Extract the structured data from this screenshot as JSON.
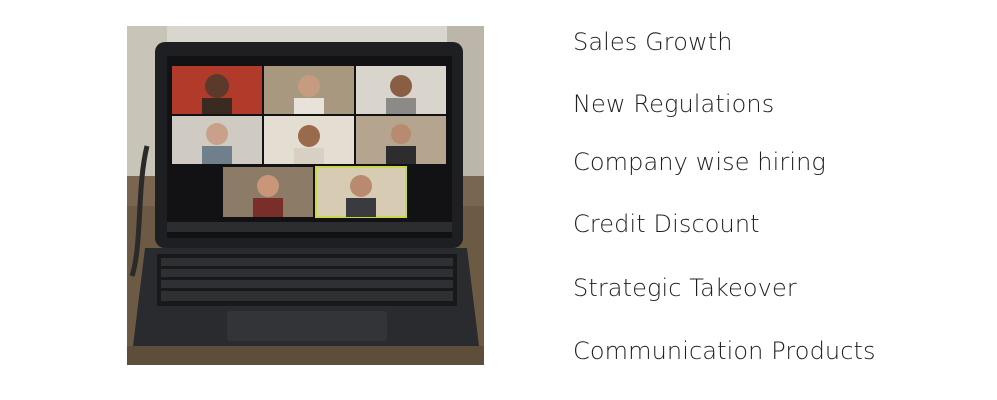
{
  "photo": {
    "icon": "laptop-video-call-photo"
  },
  "topics": [
    "Sales Growth",
    "New Regulations",
    "Company wise hiring",
    "Credit Discount",
    "Strategic Takeover",
    "Communication Products"
  ]
}
